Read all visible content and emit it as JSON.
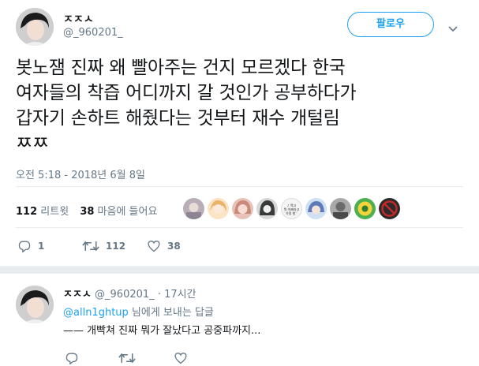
{
  "tweet": {
    "display_name": "ㅈㅈㅅ",
    "handle": "@_960201_",
    "follow_label": "팔로우",
    "text_lines": [
      "봇노잼 진짜 왜 빨아주는 건지 모르겠다 한국",
      "여자들의 착즙 어디까지 갈 것인가 공부하다가",
      "갑자기 손하트 해줬다는 것부터 재수 개털림",
      "ㅉㅉ"
    ],
    "timestamp": "오전 5:18 - 2018년 6월 8일",
    "retweet_count": "112",
    "retweet_label": "리트윗",
    "like_count": "38",
    "like_label": "마음에 들어요",
    "actions": {
      "reply": "1",
      "retweet": "112",
      "like": "38"
    },
    "liker_avatar_colors": [
      "#b9aeb8",
      "#e9b36a",
      "#c98a7c",
      "#3a3a3a",
      "#dcdcdc",
      "#5d7bb8",
      "#6b6b6b",
      "#f4d23a",
      "#c62828"
    ],
    "liker_badge_lines": [
      "♪ 먹고",
      "뭐 어쩌라고",
      "가정 발 ″"
    ]
  },
  "reply": {
    "display_name": "ㅈㅈㅅ",
    "handle": "@_960201_",
    "time": "· 17시간",
    "replying_to_handle": "@alln1ghtup",
    "replying_to_suffix": " 님에게 보내는 답글",
    "text": "—— 개빡쳐 진짜 뭐가 잘났다고 공중파까지..."
  },
  "icons": {
    "chevron": "chevron-down-icon",
    "reply": "reply-icon",
    "retweet": "retweet-icon",
    "like": "heart-icon"
  },
  "colors": {
    "accent": "#1da1f2",
    "muted": "#657786",
    "text": "#14171a",
    "divider": "#e6ecf0"
  }
}
